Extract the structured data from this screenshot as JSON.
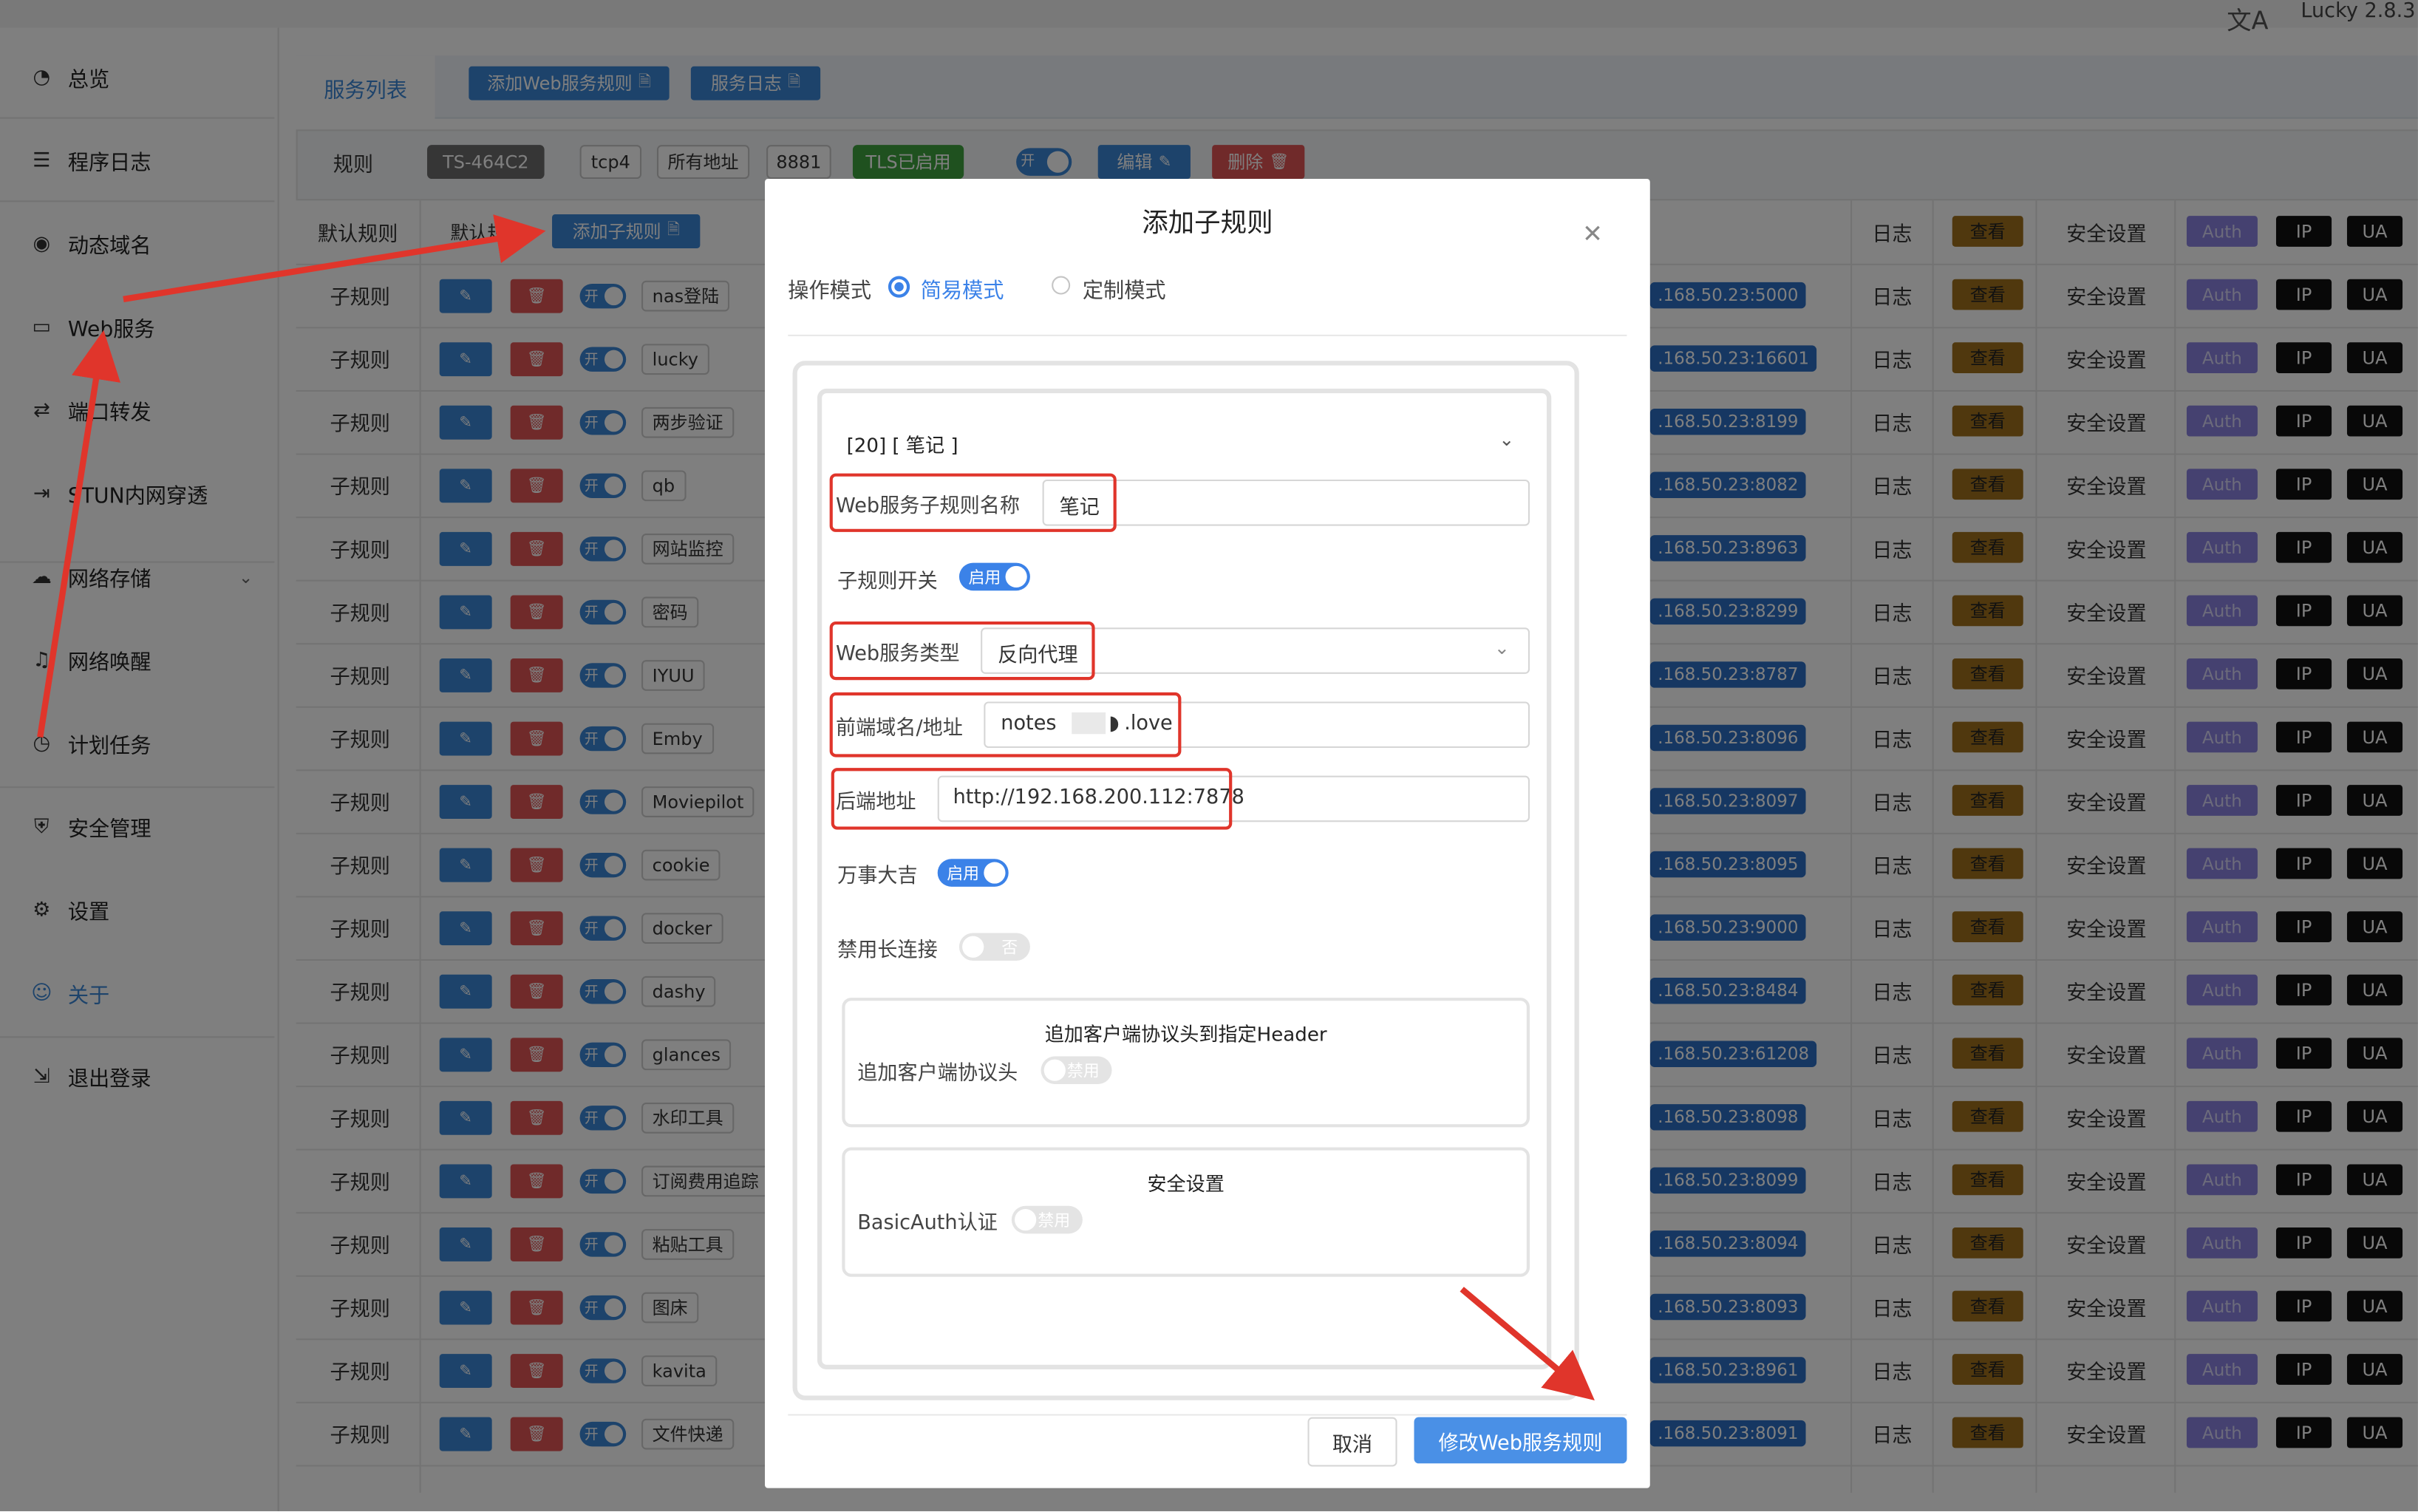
{
  "app": {
    "version": "Lucky 2.8.3",
    "lang_icon": "translate-icon"
  },
  "sidebar": {
    "items": [
      {
        "label": "总览",
        "icon": "dashboard-icon"
      },
      {
        "label": "程序日志",
        "icon": "log-icon"
      },
      {
        "label": "动态域名",
        "icon": "ddns-icon"
      },
      {
        "label": "Web服务",
        "icon": "web-service-icon"
      },
      {
        "label": "端口转发",
        "icon": "port-forward-icon"
      },
      {
        "label": "STUN内网穿透",
        "icon": "stun-icon"
      },
      {
        "label": "网络存储",
        "icon": "cloud-storage-icon"
      },
      {
        "label": "网络唤醒",
        "icon": "bell-icon"
      },
      {
        "label": "计划任务",
        "icon": "clock-icon"
      },
      {
        "label": "安全管理",
        "icon": "shield-icon"
      },
      {
        "label": "设置",
        "icon": "gear-icon"
      },
      {
        "label": "关于",
        "icon": "about-icon"
      },
      {
        "label": "退出登录",
        "icon": "logout-icon"
      }
    ]
  },
  "tabs": {
    "service_list": "服务列表",
    "add_rule": "添加Web服务规则",
    "service_log": "服务日志"
  },
  "rule_header": {
    "label": "规则",
    "name_tag": "TS-464C2",
    "protocol": "tcp4",
    "address": "所有地址",
    "port": "8881",
    "tls": "TLS已启用",
    "toggle": "开",
    "edit": "编辑",
    "delete": "删除"
  },
  "default_rule": {
    "label": "默认规则",
    "tag": "默认规则",
    "add_sub": "添加子规则"
  },
  "table": {
    "sub_label": "子规则",
    "log": "日志",
    "view": "查看",
    "security": "安全设置",
    "auth": "Auth",
    "ip": "IP",
    "ua": "UA",
    "toggle": "开",
    "rows": [
      {
        "name": "nas登陆",
        "ip": ".168.50.23:5000"
      },
      {
        "name": "lucky",
        "ip": ".168.50.23:16601"
      },
      {
        "name": "两步验证",
        "ip": ".168.50.23:8199"
      },
      {
        "name": "qb",
        "ip": ".168.50.23:8082"
      },
      {
        "name": "网站监控",
        "ip": ".168.50.23:8963"
      },
      {
        "name": "密码",
        "ip": ".168.50.23:8299"
      },
      {
        "name": "IYUU",
        "ip": ".168.50.23:8787"
      },
      {
        "name": "Emby",
        "ip": ".168.50.23:8096"
      },
      {
        "name": "Moviepilot",
        "ip": ".168.50.23:8097"
      },
      {
        "name": "cookie",
        "ip": ".168.50.23:8095"
      },
      {
        "name": "docker",
        "ip": ".168.50.23:9000"
      },
      {
        "name": "dashy",
        "ip": ".168.50.23:8484"
      },
      {
        "name": "glances",
        "ip": ".168.50.23:61208"
      },
      {
        "name": "水印工具",
        "ip": ".168.50.23:8098"
      },
      {
        "name": "订阅费用追踪",
        "ip": ".168.50.23:8099"
      },
      {
        "name": "粘贴工具",
        "ip": ".168.50.23:8094"
      },
      {
        "name": "图床",
        "ip": ".168.50.23:8093"
      },
      {
        "name": "kavita",
        "ip": ".168.50.23:8961"
      },
      {
        "name": "文件快递",
        "ip": ".168.50.23:8091"
      }
    ]
  },
  "modal": {
    "title": "添加子规则",
    "mode_label": "操作模式",
    "mode_simple": "简易模式",
    "mode_custom": "定制模式",
    "collapse_title": "[20] [ 笔记 ]",
    "name_label": "Web服务子规则名称",
    "name_value": "笔记",
    "switch_label": "子规则开关",
    "switch_on": "启用",
    "type_label": "Web服务类型",
    "type_value": "反向代理",
    "frontend_label": "前端域名/地址",
    "frontend_value_a": "notes",
    "frontend_value_b": ".love",
    "backend_label": "后端地址",
    "backend_value": "http://192.168.200.112:7878",
    "lucky_label": "万事大吉",
    "lucky_on": "启用",
    "keepalive_label": "禁用长连接",
    "keepalive_off": "否",
    "header_section_title": "追加客户端协议头到指定Header",
    "header_label": "追加客户端协议头",
    "header_off": "禁用",
    "security_title": "安全设置",
    "basic_auth_label": "BasicAuth认证",
    "basic_auth_off": "禁用",
    "cancel": "取消",
    "submit": "修改Web服务规则"
  },
  "colors": {
    "primary": "#3a86d6",
    "danger": "#e05555",
    "annotation": "#e0352b"
  }
}
